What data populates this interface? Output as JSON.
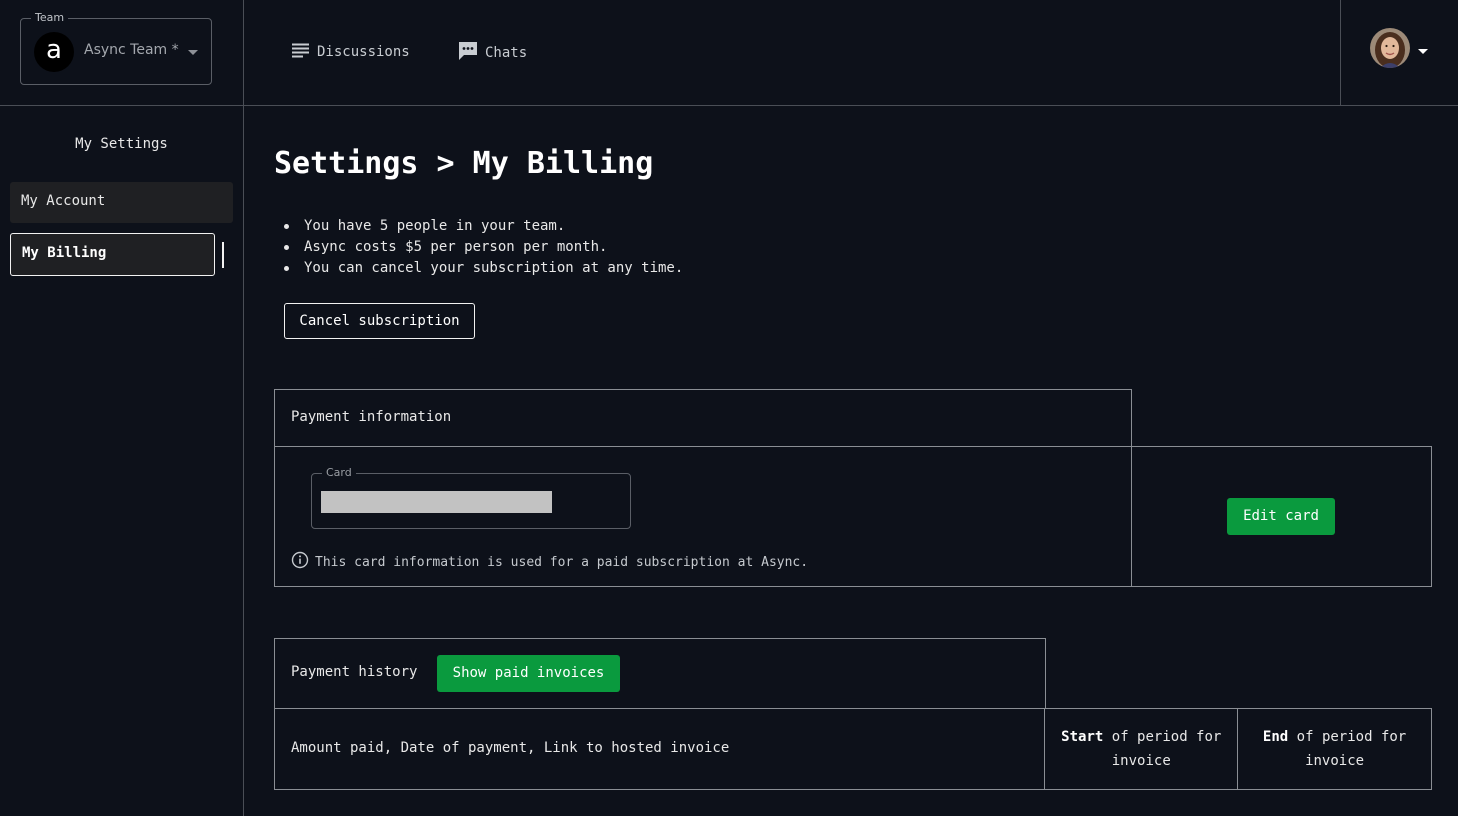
{
  "team": {
    "legend": "Team",
    "logo_letter": "a",
    "name": "Async Team *"
  },
  "sidebar": {
    "title": "My Settings",
    "items": [
      {
        "label": "My Account",
        "active": false
      },
      {
        "label": "My Billing",
        "active": true
      }
    ]
  },
  "header": {
    "nav": [
      {
        "label": "Discussions",
        "icon": "list-icon"
      },
      {
        "label": "Chats",
        "icon": "chat-bubble-icon"
      }
    ],
    "profile_icon": "user-avatar"
  },
  "main": {
    "title": "Settings > My Billing",
    "bullets": [
      "You have 5 people in your team.",
      "Async costs $5 per person per month.",
      "You can cancel your subscription at any time."
    ],
    "cancel_label": "Cancel subscription"
  },
  "payment_info": {
    "title": "Payment information",
    "card_legend": "Card",
    "note": "This card information is used for a paid subscription at Async.",
    "note_icon": "info-circle-icon",
    "edit_label": "Edit card"
  },
  "payment_history": {
    "title": "Payment history",
    "show_label": "Show paid invoices",
    "columns": {
      "main": "Amount paid, Date of payment, Link to hosted invoice",
      "start_bold": "Start",
      "start_rest": "of period for invoice",
      "end_bold": "End",
      "end_rest": "of period for invoice"
    }
  },
  "colors": {
    "background": "#0d111a",
    "accent_green": "#0a9a3e",
    "border": "#8a8e94"
  }
}
